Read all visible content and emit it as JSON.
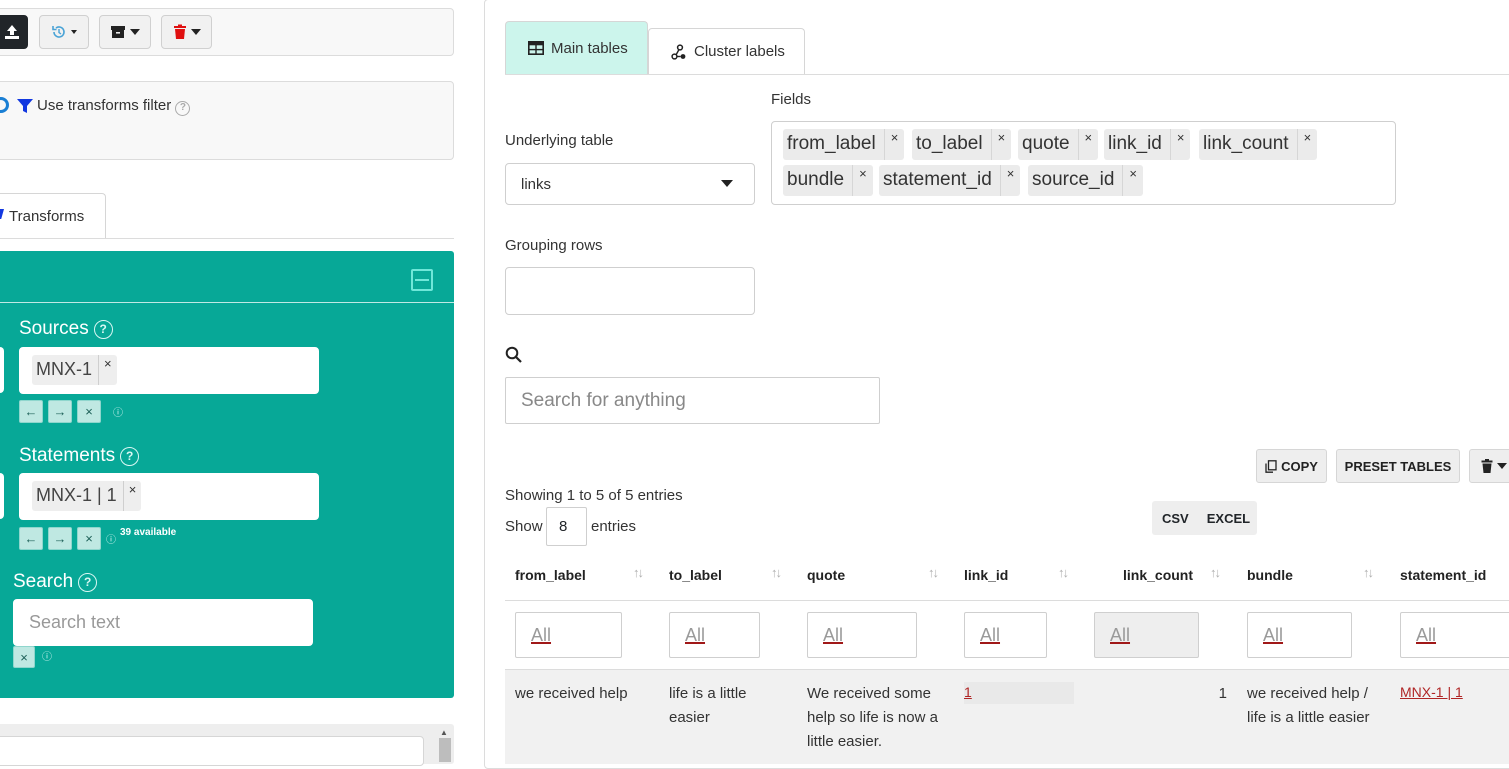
{
  "left": {
    "filter_label": "Use transforms filter",
    "tab_transforms": "Transforms",
    "sources": {
      "title": "Sources",
      "chip": "MNX-1"
    },
    "statements": {
      "title": "Statements",
      "chip": "MNX-1 | 1",
      "available": "39 available"
    },
    "search": {
      "title": "Search",
      "placeholder": "Search text"
    }
  },
  "right": {
    "tabs": [
      {
        "label": "Main tables"
      },
      {
        "label": "Cluster labels"
      }
    ],
    "fields_label": "Fields",
    "underlying_label": "Underlying table",
    "underlying_value": "links",
    "fields": [
      "from_label",
      "to_label",
      "quote",
      "link_id",
      "link_count",
      "bundle",
      "statement_id",
      "source_id"
    ],
    "grouping_label": "Grouping rows",
    "search_placeholder": "Search for anything",
    "buttons": {
      "copy": "COPY",
      "preset": "PRESET TABLES",
      "csv": "CSV",
      "excel": "EXCEL"
    },
    "info": "Showing 1 to 5 of 5 entries",
    "show_label": "Show",
    "show_value": "8",
    "entries_label": "entries",
    "columns": [
      "from_label",
      "to_label",
      "quote",
      "link_id",
      "link_count",
      "bundle",
      "statement_id"
    ],
    "filter_all": "All",
    "row1": {
      "from_label": "we received help",
      "to_label": "life is a little easier",
      "quote": "We received some help so life is now a little easier.",
      "link_id": "1",
      "link_count": "1",
      "bundle": "we received help / life is a little easier",
      "statement_id": "MNX-1 | 1"
    }
  },
  "colors": {
    "teal": "#07a897",
    "active_tab": "#ccf5ec",
    "link": "#b02525"
  }
}
